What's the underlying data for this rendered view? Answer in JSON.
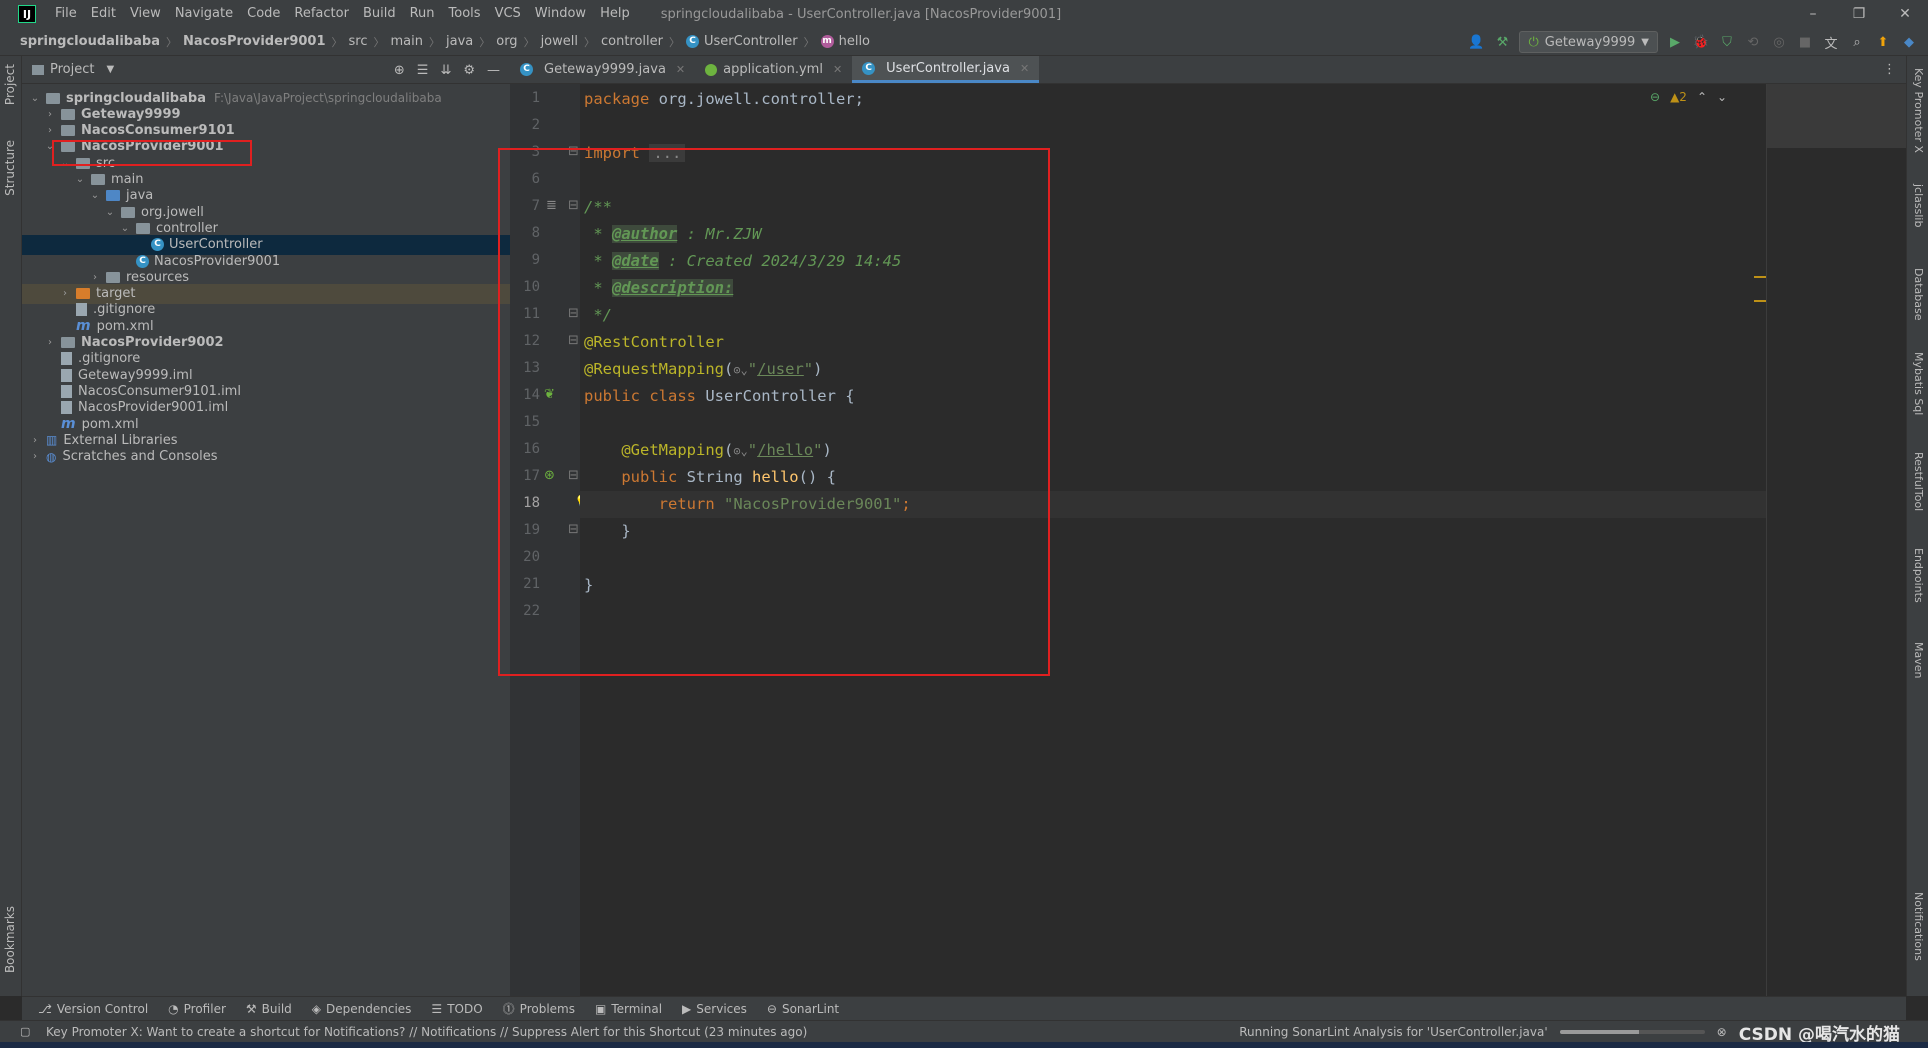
{
  "window": {
    "title": "springcloudalibaba - UserController.java [NacosProvider9001]",
    "logo": "IJ",
    "controls": [
      "minimize-icon",
      "restore-icon",
      "close-icon"
    ],
    "control_glyphs": [
      "–",
      "❐",
      "✕"
    ]
  },
  "menu": [
    "File",
    "Edit",
    "View",
    "Navigate",
    "Code",
    "Refactor",
    "Build",
    "Run",
    "Tools",
    "VCS",
    "Window",
    "Help"
  ],
  "breadcrumb": [
    "springcloudalibaba",
    "NacosProvider9001",
    "src",
    "main",
    "java",
    "org",
    "jowell",
    "controller",
    "UserController",
    "hello"
  ],
  "toolbar": {
    "run_config": "Geteway9999"
  },
  "left_stripe": {
    "project": "Project",
    "structure": "Structure",
    "bookmarks": "Bookmarks"
  },
  "right_stripe": [
    "Key Promoter X",
    "jclasslib",
    "Database",
    "Mybatis Sql",
    "RestfulTool",
    "Endpoints",
    "Maven",
    "Notifications"
  ],
  "project_panel": {
    "title": "Project",
    "tree": [
      {
        "label": "springcloudalibaba",
        "hint": "F:\\Java\\JavaProject\\springcloudalibaba",
        "depth": 0,
        "arrow": "v",
        "icon": "module-folder",
        "bold": true
      },
      {
        "label": "Geteway9999",
        "depth": 1,
        "arrow": ">",
        "icon": "module-folder",
        "bold": true
      },
      {
        "label": "NacosConsumer9101",
        "depth": 1,
        "arrow": ">",
        "icon": "module-folder",
        "bold": true
      },
      {
        "label": "NacosProvider9001",
        "depth": 1,
        "arrow": "v",
        "icon": "module-folder",
        "bold": true
      },
      {
        "label": "src",
        "depth": 2,
        "arrow": "v",
        "icon": "folder"
      },
      {
        "label": "main",
        "depth": 3,
        "arrow": "v",
        "icon": "folder"
      },
      {
        "label": "java",
        "depth": 4,
        "arrow": "v",
        "icon": "source-folder"
      },
      {
        "label": "org.jowell",
        "depth": 5,
        "arrow": "v",
        "icon": "package"
      },
      {
        "label": "controller",
        "depth": 6,
        "arrow": "v",
        "icon": "package"
      },
      {
        "label": "UserController",
        "depth": 7,
        "arrow": "",
        "icon": "class",
        "selected": true
      },
      {
        "label": "NacosProvider9001",
        "depth": 6,
        "arrow": "",
        "icon": "spring-class"
      },
      {
        "label": "resources",
        "depth": 4,
        "arrow": ">",
        "icon": "resources-folder"
      },
      {
        "label": "target",
        "depth": 2,
        "arrow": ">",
        "icon": "excluded-folder",
        "target": true
      },
      {
        "label": ".gitignore",
        "depth": 2,
        "arrow": "",
        "icon": "gitignore"
      },
      {
        "label": "pom.xml",
        "depth": 2,
        "arrow": "",
        "icon": "maven"
      },
      {
        "label": "NacosProvider9002",
        "depth": 1,
        "arrow": ">",
        "icon": "module-folder",
        "bold": true
      },
      {
        "label": ".gitignore",
        "depth": 1,
        "arrow": "",
        "icon": "gitignore"
      },
      {
        "label": "Geteway9999.iml",
        "depth": 1,
        "arrow": "",
        "icon": "iml"
      },
      {
        "label": "NacosConsumer9101.iml",
        "depth": 1,
        "arrow": "",
        "icon": "iml"
      },
      {
        "label": "NacosProvider9001.iml",
        "depth": 1,
        "arrow": "",
        "icon": "iml"
      },
      {
        "label": "pom.xml",
        "depth": 1,
        "arrow": "",
        "icon": "maven"
      },
      {
        "label": "External Libraries",
        "depth": 0,
        "arrow": ">",
        "icon": "library"
      },
      {
        "label": "Scratches and Consoles",
        "depth": 0,
        "arrow": ">",
        "icon": "scratches"
      }
    ]
  },
  "editor_tabs": [
    {
      "label": "Geteway9999.java",
      "icon": "spring-class-icon",
      "active": false
    },
    {
      "label": "application.yml",
      "icon": "yml-icon",
      "active": false
    },
    {
      "label": "UserController.java",
      "icon": "class-icon",
      "active": true
    }
  ],
  "inspections": {
    "warnings": "▲2",
    "color": "#be9117"
  },
  "editor": {
    "current_line": 18,
    "lines": [
      {
        "n": "1",
        "html": "<span class=\"kw\">package</span> org.jowell.controller;"
      },
      {
        "n": "2",
        "html": ""
      },
      {
        "n": "3",
        "html": "<span class=\"kw\">import</span> <span class=\"fold\">...</span>"
      },
      {
        "n": "6",
        "html": ""
      },
      {
        "n": "7",
        "html": "<span class=\"doc\">/**</span>"
      },
      {
        "n": "8",
        "html": "<span class=\"doc\"> * </span><span class=\"doctag\">@author</span><span class=\"doc\"> : Mr.ZJW</span>"
      },
      {
        "n": "9",
        "html": "<span class=\"doc\"> * </span><span class=\"doctag\">@date</span><span class=\"doc\"> : Created 2024/3/29 14:45</span>"
      },
      {
        "n": "10",
        "html": "<span class=\"doc\"> * </span><span class=\"doctag\">@description:</span>"
      },
      {
        "n": "11",
        "html": "<span class=\"doc\"> */</span>"
      },
      {
        "n": "12",
        "html": "<span class=\"ann\">@RestController</span>"
      },
      {
        "n": "13",
        "html": "<span class=\"ann\">@RequestMapping</span>(<span class=\"chip\">⊙⌄</span><span class=\"str\">\"</span><span class=\"ulnk\">/user</span><span class=\"str\">\"</span>)"
      },
      {
        "n": "14",
        "html": "<span class=\"kw\">public class</span> UserController {"
      },
      {
        "n": "15",
        "html": ""
      },
      {
        "n": "16",
        "html": "    <span class=\"ann\">@GetMapping</span>(<span class=\"chip\">⊙⌄</span><span class=\"str\">\"</span><span class=\"ulnk\">/hello</span><span class=\"str\">\"</span>)"
      },
      {
        "n": "17",
        "html": "    <span class=\"kw\">public</span> String <span class=\"fn\">hello</span>() {"
      },
      {
        "n": "18",
        "html": "        <span class=\"kw\">return</span> <span class=\"str\">\"NacosProvider9001\"</span><span class=\"kw\">;</span>"
      },
      {
        "n": "19",
        "html": "    }"
      },
      {
        "n": "20",
        "html": ""
      },
      {
        "n": "21",
        "html": "}"
      },
      {
        "n": "22",
        "html": ""
      }
    ]
  },
  "tool_windows": [
    {
      "label": "Version Control",
      "icon": "⎇"
    },
    {
      "label": "Profiler",
      "icon": "◔"
    },
    {
      "label": "Build",
      "icon": "⚒"
    },
    {
      "label": "Dependencies",
      "icon": "◈"
    },
    {
      "label": "TODO",
      "icon": "☰"
    },
    {
      "label": "Problems",
      "icon": "⓵"
    },
    {
      "label": "Terminal",
      "icon": "▣"
    },
    {
      "label": "Services",
      "icon": "▶"
    },
    {
      "label": "SonarLint",
      "icon": "⊖"
    }
  ],
  "status": {
    "message": "Key Promoter X: Want to create a shortcut for Notifications? // Notifications // Suppress Alert for this Shortcut (23 minutes ago)",
    "analysis": "Running SonarLint Analysis for 'UserController.java'",
    "progress": 0.55,
    "watermark": "CSDN @喝汽水的猫"
  },
  "colors": {
    "highlight_box": "#e02020",
    "accent": "#4a88c7"
  }
}
